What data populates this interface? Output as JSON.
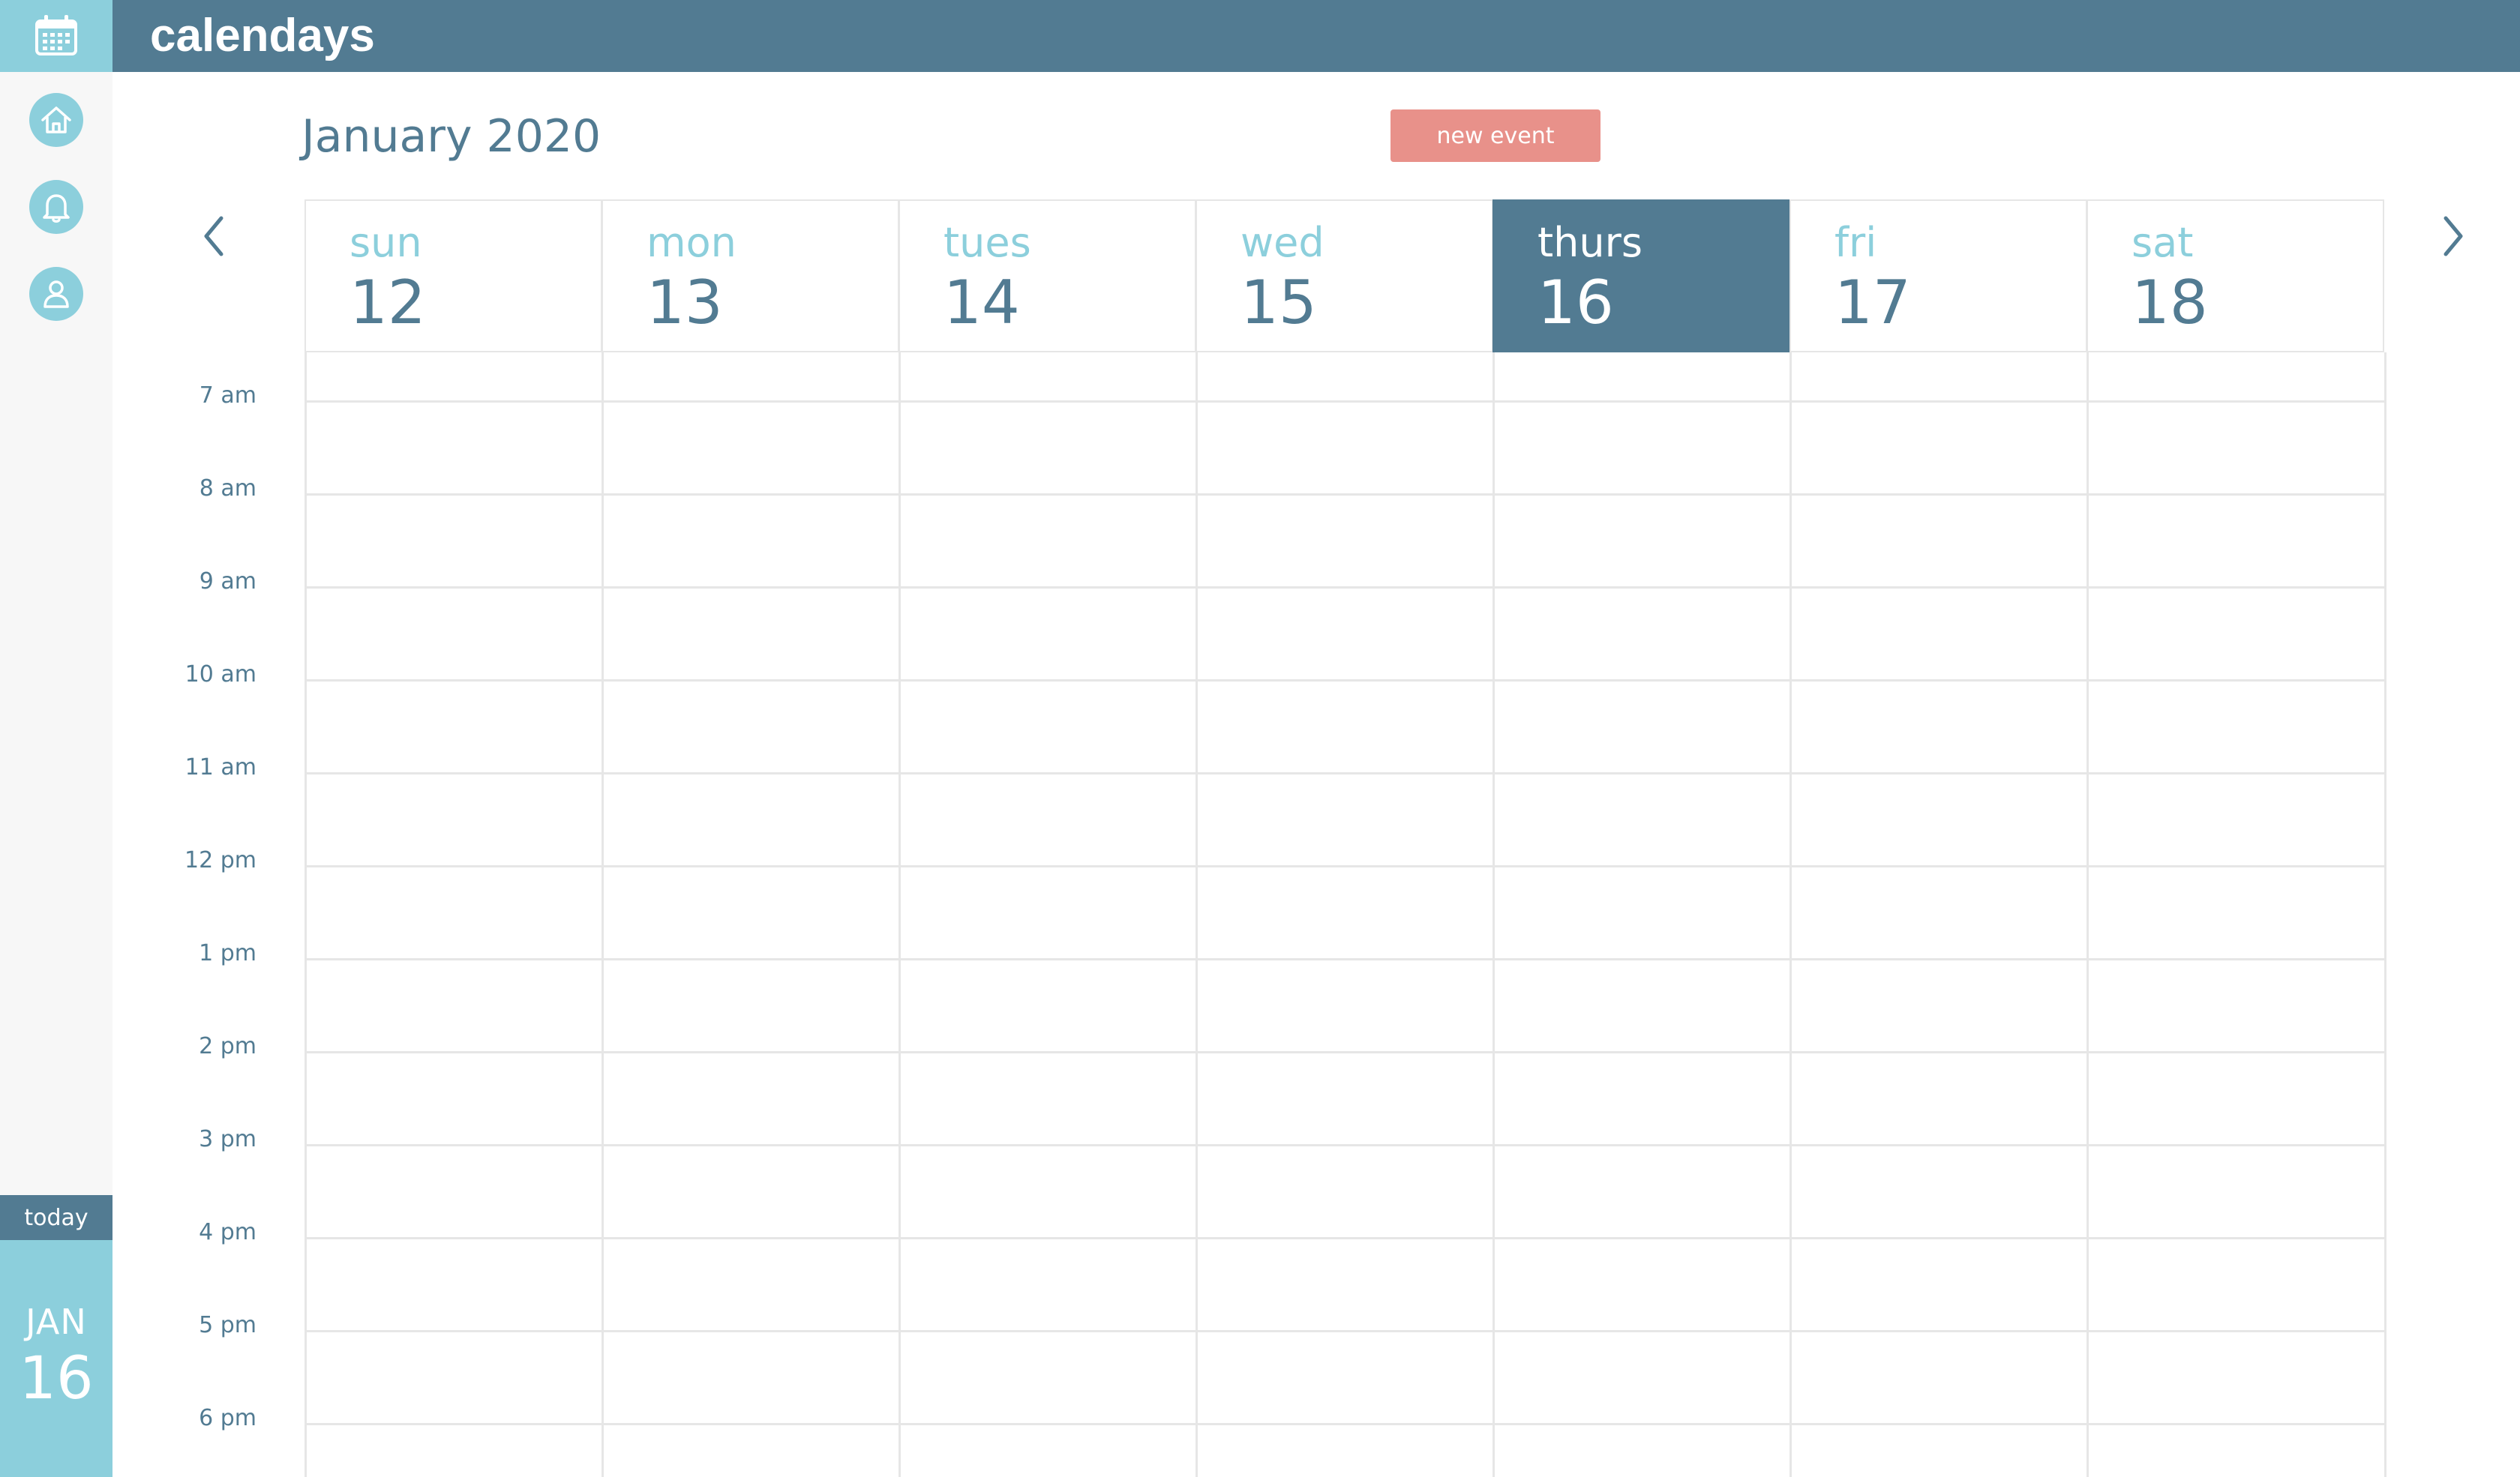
{
  "app": {
    "title": "calendays"
  },
  "sidebar": {
    "logo_icon": "calendar-icon",
    "nav": [
      {
        "icon": "home-icon"
      },
      {
        "icon": "bell-icon"
      },
      {
        "icon": "user-icon"
      }
    ],
    "today_label": "today",
    "today_month": "JAN",
    "today_day": "16"
  },
  "header": {
    "month_title": "January 2020",
    "new_event_label": "new event",
    "prev_icon": "chevron-left-icon",
    "next_icon": "chevron-right-icon"
  },
  "week": {
    "days": [
      {
        "name": "sun",
        "date": "12"
      },
      {
        "name": "mon",
        "date": "13"
      },
      {
        "name": "tues",
        "date": "14"
      },
      {
        "name": "wed",
        "date": "15"
      },
      {
        "name": "thurs",
        "date": "16",
        "active": true
      },
      {
        "name": "fri",
        "date": "17"
      },
      {
        "name": "sat",
        "date": "18"
      }
    ]
  },
  "times": [
    "7 am",
    "8 am",
    "9 am",
    "10 am",
    "11 am",
    "12 pm",
    "1 pm",
    "2 pm",
    "3 pm",
    "4 pm",
    "5 pm",
    "6 pm"
  ],
  "colors": {
    "primary": "#527b92",
    "accent": "#8ccfdc",
    "button": "#e8918a",
    "grid": "#e6e6e6",
    "sidebar_bg": "#f7f7f7"
  }
}
